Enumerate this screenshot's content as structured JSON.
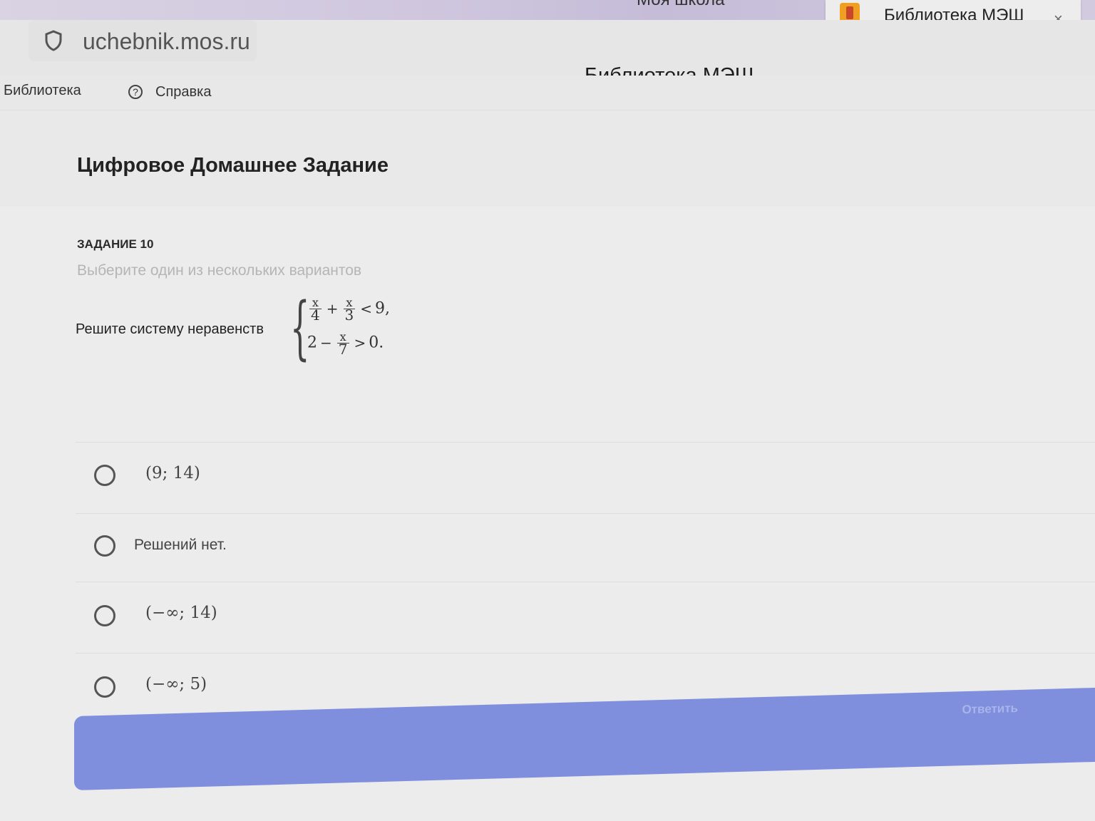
{
  "browser": {
    "tabs": [
      {
        "title": "Моя школа"
      },
      {
        "title": "Библиотека МЭШ",
        "close_label": "×"
      }
    ],
    "url": "uchebnik.mos.ru",
    "page_heading": "Библиотека МЭШ"
  },
  "nav": {
    "library": "Библиотека",
    "help_icon_glyph": "?",
    "help": "Справка"
  },
  "main": {
    "title": "Цифровое Домашнее Задание"
  },
  "task": {
    "number": "ЗАДАНИЕ 10",
    "instruction": "Выберите один из нескольких вариантов",
    "prompt": "Решите систему неравенств",
    "system": {
      "line1": {
        "frac1_num": "x",
        "frac1_den": "4",
        "op": "+",
        "frac2_num": "x",
        "frac2_den": "3",
        "rel": "<",
        "rhs": "9,"
      },
      "line2": {
        "lhs": "2",
        "op": "−",
        "frac_num": "x",
        "frac_den": "7",
        "rel": ">",
        "rhs": "0."
      }
    }
  },
  "options": [
    {
      "label": "(9; 14)"
    },
    {
      "label": "Решений нет."
    },
    {
      "label": "(−∞; 14)"
    },
    {
      "label": "(−∞; 5)"
    }
  ],
  "submit": {
    "label": "Ответить"
  },
  "colors": {
    "accent": "#7f8fdd",
    "tabstrip": "#cfc6de"
  }
}
